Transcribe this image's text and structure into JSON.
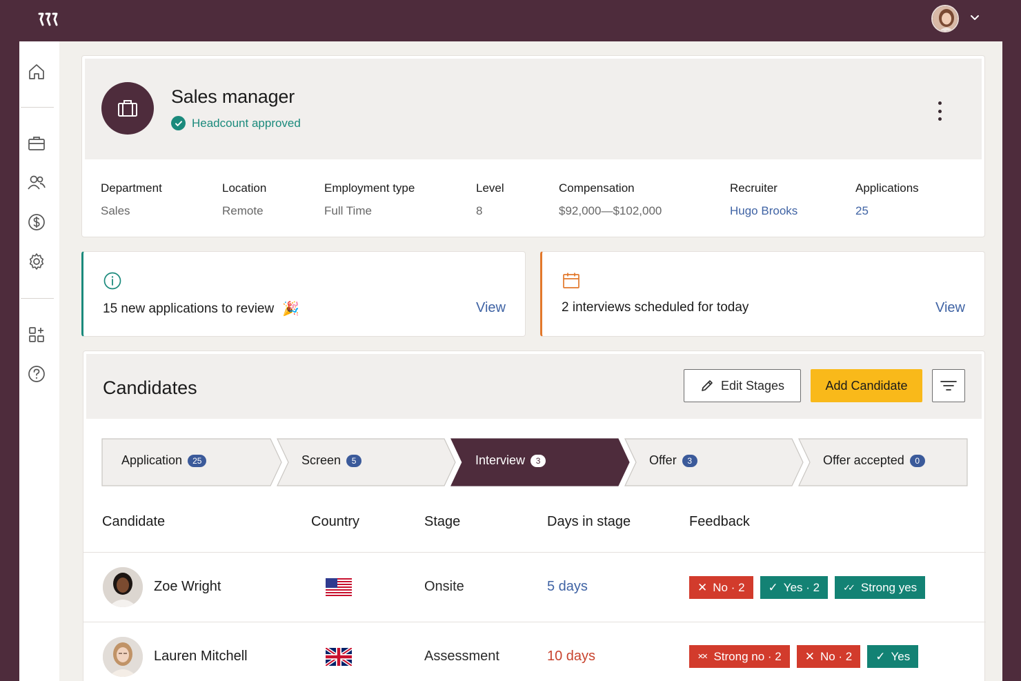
{
  "colors": {
    "brand": "#4e2c3c",
    "accent": "#f9b91a",
    "link": "#3f63a4",
    "success": "#1b8a7c",
    "danger": "#d23b2c"
  },
  "header": {
    "logo_icon": "brand-logo-icon",
    "avatar_icon": "user-avatar",
    "menu_icon": "chevron-down-icon"
  },
  "sidebar": {
    "items": [
      "home-icon",
      "briefcase-icon",
      "people-icon",
      "dollar-icon",
      "gear-icon",
      "apps-add-icon",
      "help-icon"
    ]
  },
  "job": {
    "title": "Sales manager",
    "status": "Headcount approved",
    "fields": [
      {
        "label": "Department",
        "value": "Sales"
      },
      {
        "label": "Location",
        "value": "Remote"
      },
      {
        "label": "Employment type",
        "value": "Full Time"
      },
      {
        "label": "Level",
        "value": "8"
      },
      {
        "label": "Compensation",
        "value": "$92,000—$102,000"
      },
      {
        "label": "Recruiter",
        "value": "Hugo Brooks"
      },
      {
        "label": "Applications",
        "value": "25"
      }
    ]
  },
  "notices": [
    {
      "text": "15 new applications to review",
      "emoji": "🎉",
      "action": "View",
      "icon": "info-icon"
    },
    {
      "text": "2 interviews scheduled for today",
      "action": "View",
      "icon": "calendar-icon"
    }
  ],
  "candidates": {
    "title": "Candidates",
    "edit_label": "Edit Stages",
    "add_label": "Add Candidate",
    "stages": [
      {
        "name": "Application",
        "count": "25"
      },
      {
        "name": "Screen",
        "count": "5"
      },
      {
        "name": "Interview",
        "count": "3",
        "active": true
      },
      {
        "name": "Offer",
        "count": "3"
      },
      {
        "name": "Offer accepted",
        "count": "0"
      }
    ],
    "columns": [
      "Candidate",
      "Country",
      "Stage",
      "Days in stage",
      "Feedback"
    ],
    "rows": [
      {
        "name": "Zoe Wright",
        "country": "us-flag-icon",
        "stage": "Onsite",
        "days": "5 days",
        "feedback": [
          {
            "icon": "✕",
            "text": "No · 2",
            "tone": "red"
          },
          {
            "icon": "✓",
            "text": "Yes · 2",
            "tone": "teal"
          },
          {
            "icon": "✓✓",
            "text": "Strong yes",
            "tone": "teal"
          }
        ]
      },
      {
        "name": "Lauren Mitchell",
        "country": "uk-flag-icon",
        "stage": "Assessment",
        "days": "10 days",
        "feedback": [
          {
            "icon": "✕✕",
            "text": "Strong no · 2",
            "tone": "red"
          },
          {
            "icon": "✕",
            "text": "No · 2",
            "tone": "red"
          },
          {
            "icon": "✓",
            "text": "Yes",
            "tone": "teal"
          }
        ]
      }
    ]
  }
}
